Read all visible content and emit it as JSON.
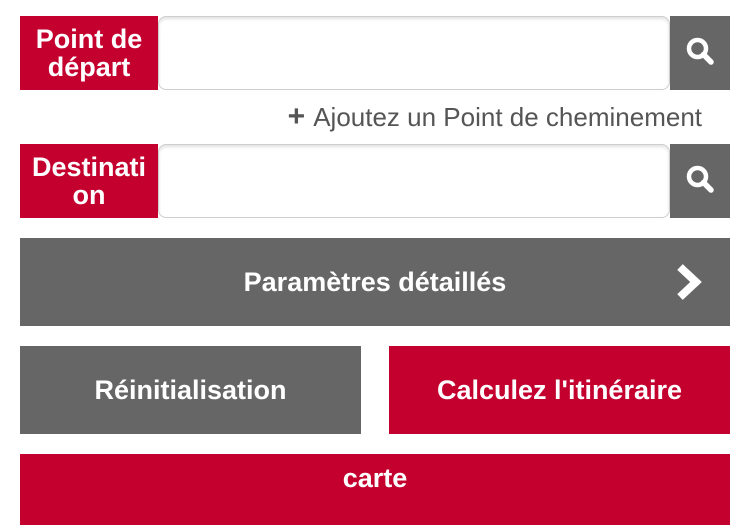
{
  "colors": {
    "accent_red": "#c4002f",
    "button_gray": "#666666",
    "text_gray": "#555555"
  },
  "start": {
    "label": "Point de départ",
    "value": "",
    "placeholder": "",
    "search_icon": "search-icon"
  },
  "waypoint": {
    "icon": "plus-icon",
    "label": "Ajoutez un Point de cheminement"
  },
  "destination": {
    "label": "Destinati on",
    "value": "",
    "placeholder": "",
    "search_icon": "search-icon"
  },
  "buttons": {
    "detail_settings": "Paramètres détaillés",
    "detail_icon": "chevron-right-icon",
    "reset": "Réinitialisation",
    "calculate": "Calculez l'itinéraire",
    "map": "carte"
  }
}
